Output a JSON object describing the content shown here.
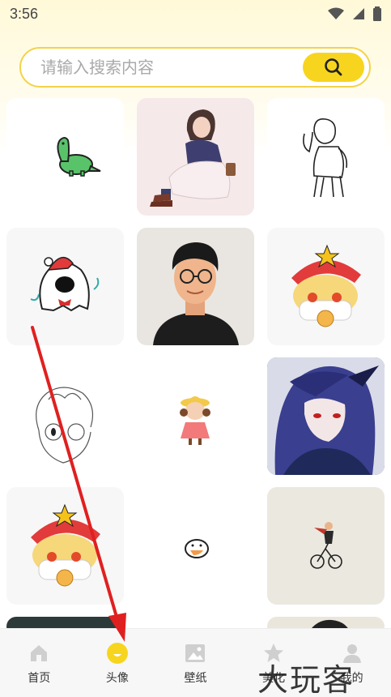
{
  "status_bar": {
    "time": "3:56"
  },
  "search": {
    "placeholder": "请输入搜索内容"
  },
  "grid": {
    "items": [
      "dinosaur sticker",
      "girl sitting illustration",
      "line-art boy",
      "ghost with santa hat",
      "man with glasses avatar",
      "blonde chibi santa hat",
      "sketch boy",
      "little girl with hat",
      "blue haired anime character",
      "blonde chibi santa hat",
      "small blob",
      "cyclist illustration"
    ]
  },
  "nav": {
    "items": [
      {
        "label": "首页",
        "icon": "home-icon",
        "active": false
      },
      {
        "label": "头像",
        "icon": "avatar-icon",
        "active": true
      },
      {
        "label": "壁纸",
        "icon": "image-icon",
        "active": false
      },
      {
        "label": "美化",
        "icon": "star-icon",
        "active": false
      },
      {
        "label": "我的",
        "icon": "user-icon",
        "active": false
      }
    ]
  },
  "watermark": "大玩客",
  "colors": {
    "accent": "#f7d51f",
    "border": "#f4d24a",
    "arrow": "#e02020"
  }
}
